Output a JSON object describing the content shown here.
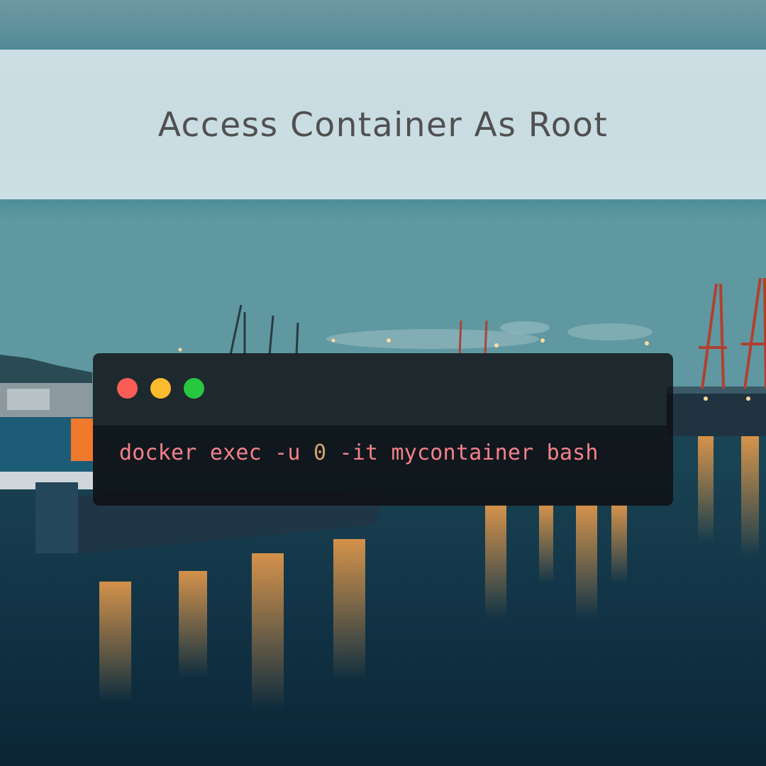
{
  "title": "Access Container As Root",
  "background": {
    "description_icon": "harbor-dusk-photo",
    "sky_color": "#3f8593",
    "water_color": "#133848",
    "light_color": "#f28c3c"
  },
  "terminal": {
    "dots": [
      {
        "name": "close",
        "color": "#fc5e57"
      },
      {
        "name": "minimize",
        "color": "#fdbb2e"
      },
      {
        "name": "maximize",
        "color": "#27c840"
      }
    ],
    "command_parts": [
      {
        "text": "docker exec -u ",
        "color": "#f4818a"
      },
      {
        "text": "0",
        "color": "#d2a36a"
      },
      {
        "text": " -it mycontainer bash",
        "color": "#f4818a"
      }
    ]
  }
}
